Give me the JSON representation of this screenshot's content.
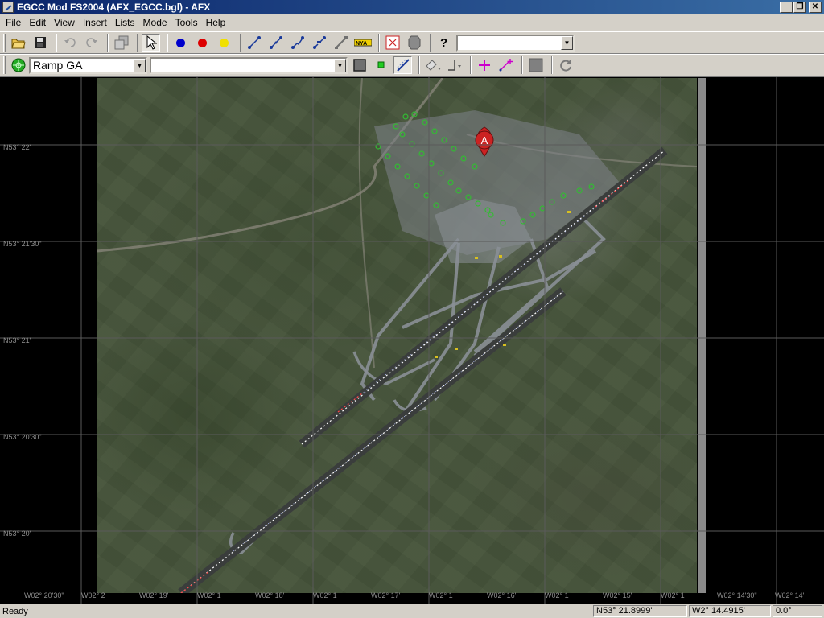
{
  "window": {
    "title": "EGCC Mod FS2004 (AFX_EGCC.bgl) - AFX"
  },
  "menu": [
    "File",
    "Edit",
    "View",
    "Insert",
    "Lists",
    "Mode",
    "Tools",
    "Help"
  ],
  "toolbar1": {
    "icons": [
      "open-folder-icon",
      "save-icon",
      "undo-icon",
      "redo-icon",
      "copy-object-icon",
      "select-arrow-icon",
      "blue-point-icon",
      "red-point-icon",
      "yellow-point-icon",
      "taxi-path-icon",
      "runway-path-icon",
      "parking-path-icon",
      "start-path-icon",
      "vector-icon",
      "taxiway-sign-icon",
      "exclusion-icon",
      "boundary-icon",
      "help-icon"
    ],
    "colors": {
      "blue": "#0000cc",
      "red": "#dd0000",
      "yellow": "#f0e000",
      "path": "#1a3a9a"
    },
    "combo_value": ""
  },
  "toolbar2": {
    "icons": [
      "green-radar-icon",
      "apron-fill-icon",
      "green-node-icon",
      "edge-line-icon",
      "paint-icon",
      "hold-short-icon",
      "add-point-icon",
      "add-link-icon",
      "grey-square-icon",
      "refresh-icon"
    ],
    "ramp_combo_value": "Ramp GA",
    "second_combo_value": "",
    "accent_colors": {
      "plus": "#cc00cc",
      "green": "#00aa00"
    }
  },
  "map": {
    "latitude_labels": [
      "N53° 22'",
      "N53° 21'30\"",
      "N53° 21'",
      "N53° 20'30\"",
      "N53° 20'"
    ],
    "longitude_labels": [
      "W02° 20'30\"",
      "W02° 2",
      "W02° 19'",
      "W02° 1",
      "W02° 18'",
      "W02° 1",
      "W02° 17'",
      "W02° 1",
      "W02° 16'",
      "W02° 1",
      "W02° 15'",
      "W02° 1",
      "W02° 14'30\"",
      "W02° 14'"
    ],
    "marker_letter": "A",
    "colors": {
      "grid": "#5a5a5a",
      "runway_lights": "#ffffff",
      "parking": "#33bb33",
      "marker": "#cc2222",
      "taxiway": "#8a8f96"
    }
  },
  "status": {
    "text": "Ready",
    "latitude": "N53° 21.8999'",
    "longitude": "W2° 14.4915'",
    "heading": "0.0°"
  }
}
